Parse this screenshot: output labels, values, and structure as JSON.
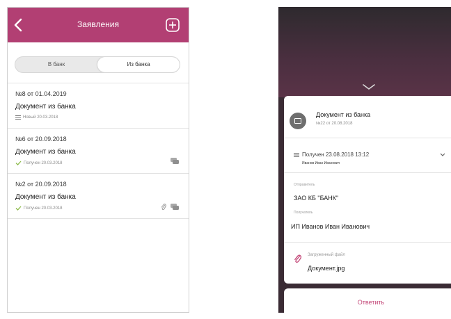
{
  "left": {
    "header": {
      "title": "Заявления"
    },
    "tabs": [
      {
        "label": "В банк"
      },
      {
        "label": "Из банка"
      }
    ],
    "items": [
      {
        "number": "№8 от 01.04.2019",
        "doc": "Документ из банка",
        "status": "Новый 20.03.2018",
        "icons": []
      },
      {
        "number": "№6 от 20.09.2018",
        "doc": "Документ из банка",
        "status": "Получен 20.03.2018",
        "icons": [
          "chat-icon"
        ]
      },
      {
        "number": "№2 от 20.09.2018",
        "doc": "Документ из банка",
        "status": "Получен 20.03.2018",
        "icons": [
          "attachment-icon",
          "chat-icon"
        ]
      }
    ]
  },
  "right": {
    "card": {
      "doc_title": "Документ из банка",
      "doc_sub": "№22 от 20.08.2018",
      "status": "Получен 23.08.2018 13:12",
      "status_person": "Иванов Иван Иванович",
      "sender_label": "Отправитель",
      "sender_value": "ЗАО КБ \"БАНК\"",
      "recipient_label": "Получатель",
      "recipient_value": "ИП Иванов Иван Иванович",
      "file_label": "Загруженный файл",
      "file_name": "Документ.jpg"
    },
    "reply_label": "Ответить"
  },
  "colors": {
    "header": "#b23f73",
    "accent": "#c44a7a",
    "check": "#8dbb4a"
  }
}
